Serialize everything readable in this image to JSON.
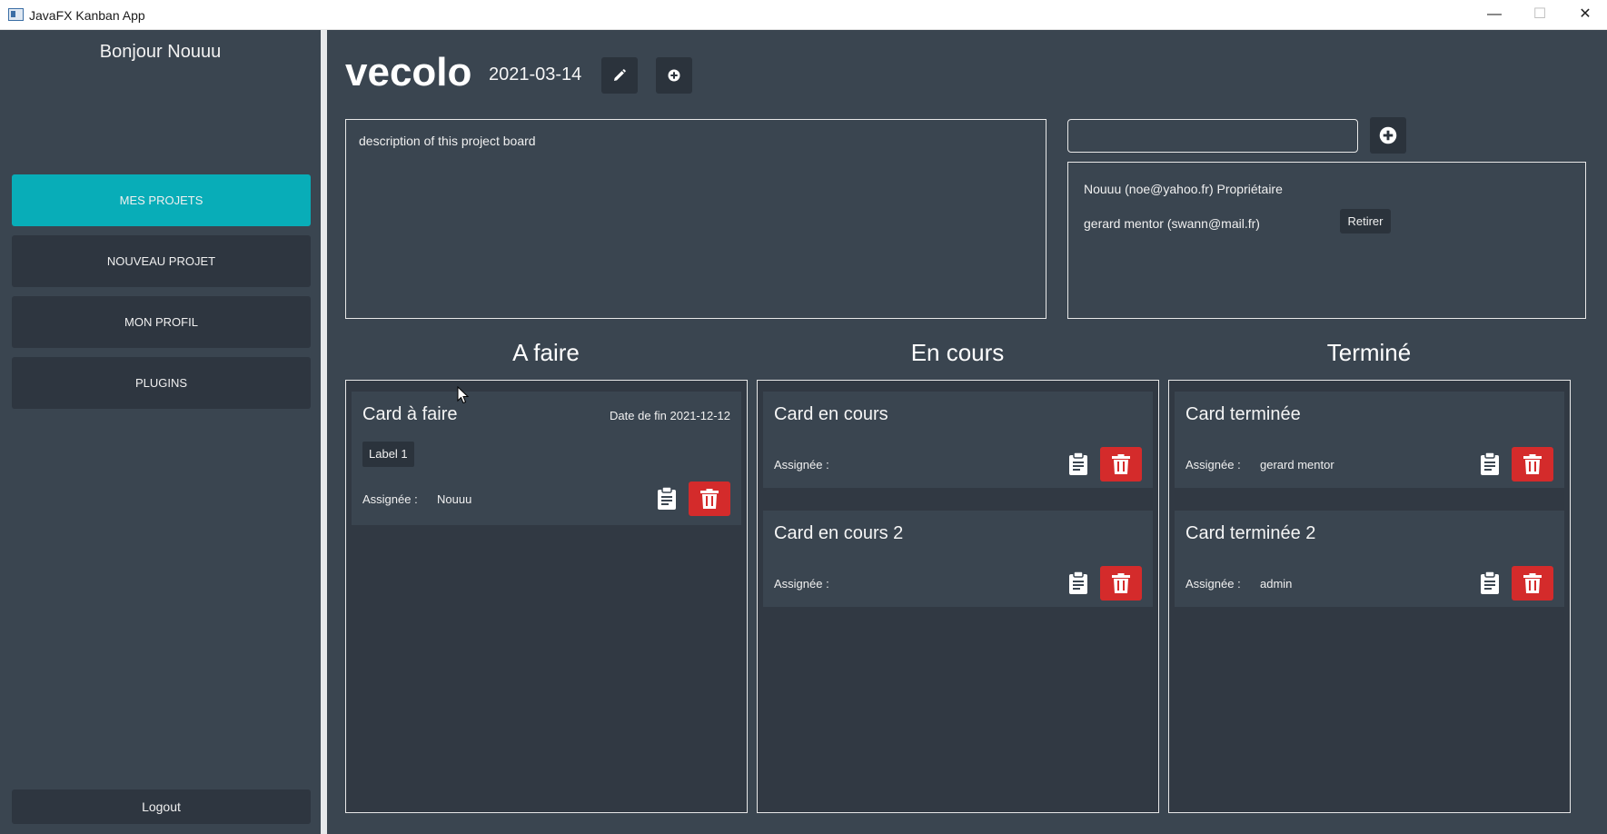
{
  "window": {
    "title": "JavaFX Kanban App",
    "minimize": "—",
    "maximize": "☐",
    "close": "✕"
  },
  "sidebar": {
    "greeting": "Bonjour Nouuu",
    "items": [
      {
        "label": "MES PROJETS",
        "active": true
      },
      {
        "label": "NOUVEAU PROJET",
        "active": false
      },
      {
        "label": "MON PROFIL",
        "active": false
      },
      {
        "label": "PLUGINS",
        "active": false
      }
    ],
    "logout": "Logout"
  },
  "project": {
    "name": "vecolo",
    "date": "2021-03-14",
    "description": "description of this project board"
  },
  "members": {
    "input_value": "",
    "list": [
      {
        "text": "Nouuu (noe@yahoo.fr) Propriétaire"
      },
      {
        "text": "gerard mentor (swann@mail.fr)",
        "action": "Retirer"
      }
    ]
  },
  "columns": [
    {
      "title": "A faire",
      "cards": [
        {
          "title": "Card à faire",
          "due": "Date de fin 2021-12-12",
          "label": "Label 1",
          "assignee_label": "Assignée :",
          "assignee": "Nouuu"
        }
      ]
    },
    {
      "title": "En cours",
      "cards": [
        {
          "title": "Card en cours",
          "assignee_label": "Assignée :",
          "assignee": ""
        },
        {
          "title": "Card en cours 2",
          "assignee_label": "Assignée :",
          "assignee": ""
        }
      ]
    },
    {
      "title": "Terminé",
      "cards": [
        {
          "title": "Card terminée",
          "assignee_label": "Assignée :",
          "assignee": "gerard mentor"
        },
        {
          "title": "Card terminée 2",
          "assignee_label": "Assignée :",
          "assignee": "admin"
        }
      ]
    }
  ],
  "icons": {
    "edit": "pencil-icon",
    "add": "plus-circle-icon",
    "clipboard": "clipboard-icon",
    "delete": "trash-icon"
  },
  "colors": {
    "background": "#3a4550",
    "sidebar_button": "#2e3640",
    "active_accent": "#08adb8",
    "column_background": "#313943",
    "delete_red": "#d42b2b"
  }
}
